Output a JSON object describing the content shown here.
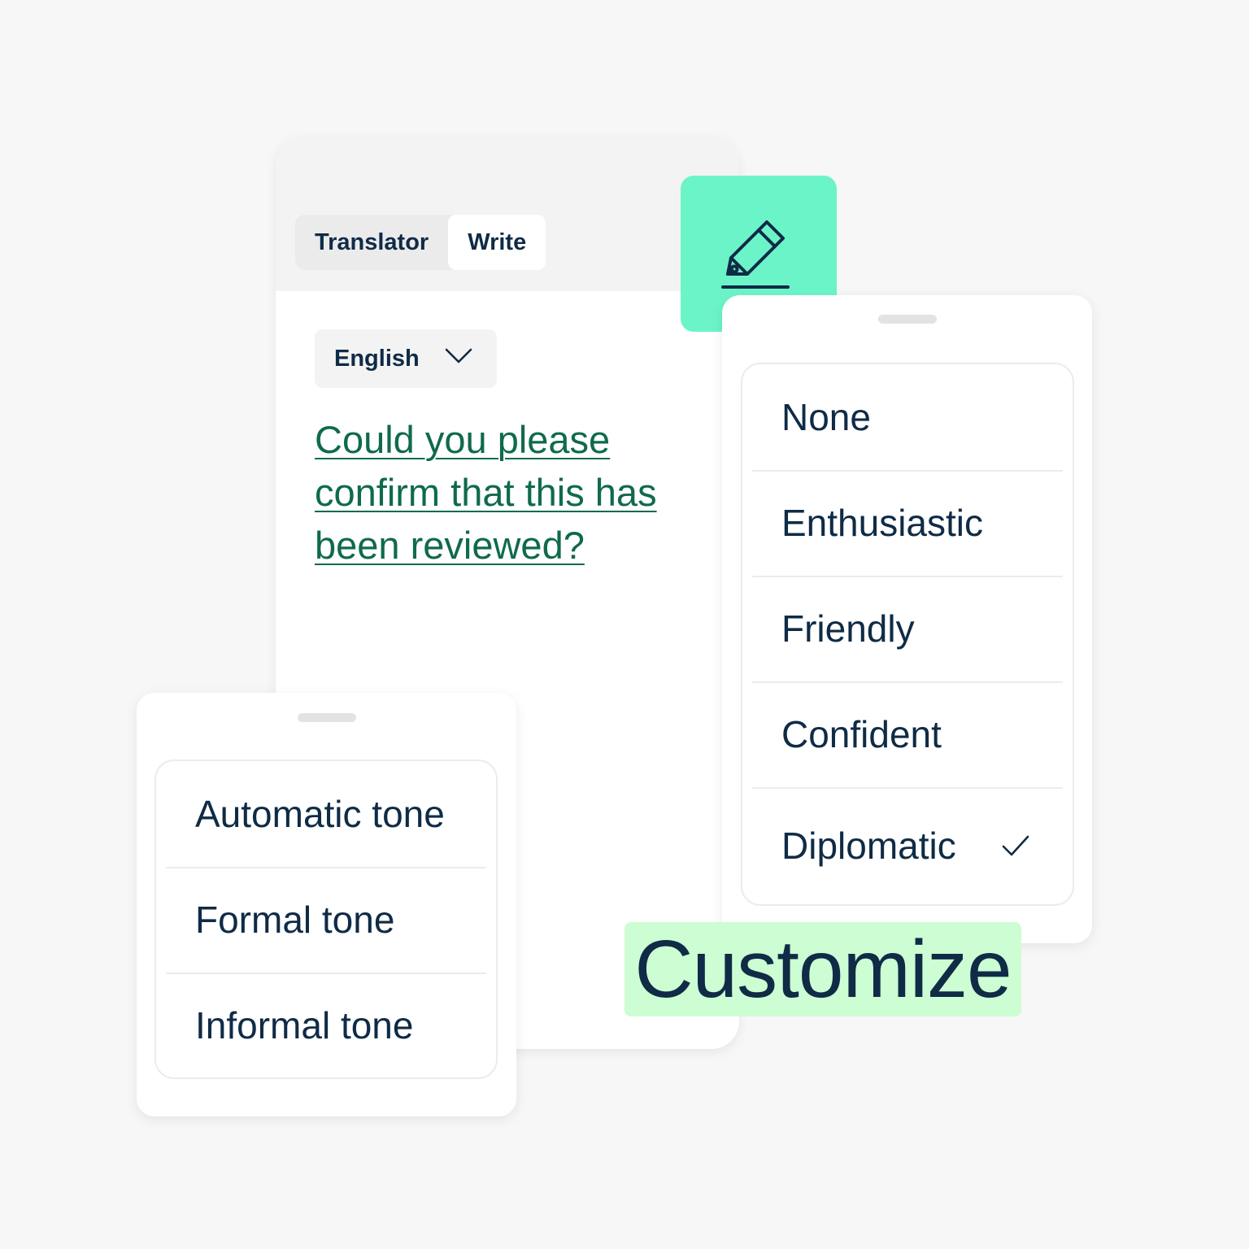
{
  "tabs": {
    "translator_label": "Translator",
    "write_label": "Write"
  },
  "editor": {
    "language": "English",
    "text": "Could you please confirm that this has been reviewed?"
  },
  "style_options": {
    "items": [
      "None",
      "Enthusiastic",
      "Friendly",
      "Confident",
      "Diplomatic"
    ],
    "selected": "Diplomatic"
  },
  "tone_options": {
    "items": [
      "Automatic tone",
      "Formal tone",
      "Informal tone"
    ]
  },
  "badge": {
    "label": "Customize"
  },
  "icons": {
    "pencil": "pencil-icon",
    "chevron": "chevron-down-icon",
    "check": "checkmark-icon"
  },
  "colors": {
    "accent_tile": "#6cf4c9",
    "badge_bg": "#ccfdd3",
    "link_text": "#0f6b4a",
    "ink": "#0f2b46"
  }
}
